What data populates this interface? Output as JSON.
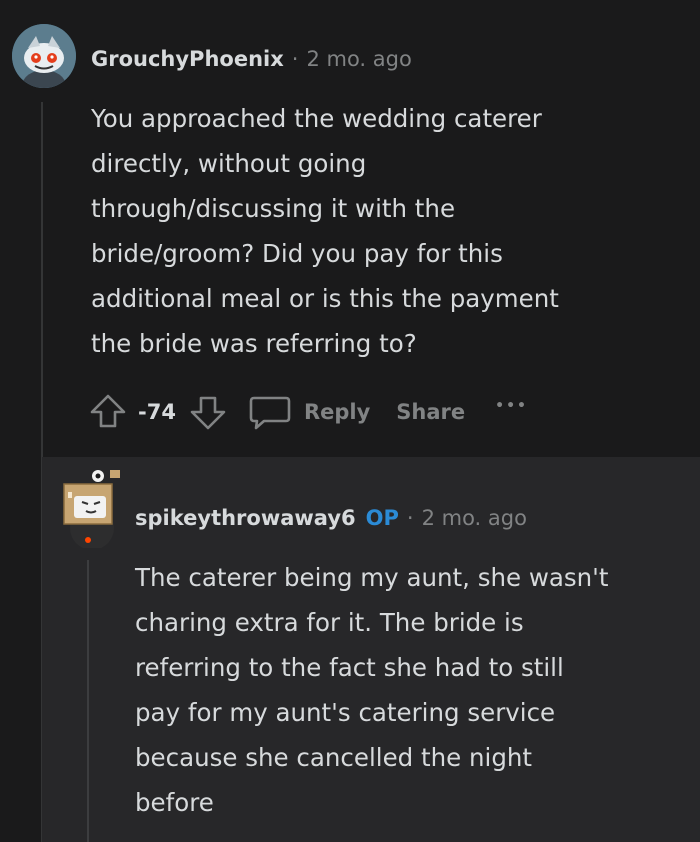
{
  "comment": {
    "author": "GrouchyPhoenix",
    "time": "2 mo. ago",
    "separator": "·",
    "body_lines": [
      "You approached the wedding caterer",
      "directly, without going",
      "through/discussing it with the",
      "bride/groom? Did you pay for this",
      "additional meal or is this the payment",
      "the bride was referring to?"
    ],
    "score": "-74",
    "reply_label": "Reply",
    "share_label": "Share",
    "more_label": "•••"
  },
  "reply": {
    "author": "spikeythrowaway6",
    "op_tag": "OP",
    "time": "2 mo. ago",
    "separator": "·",
    "body_lines": [
      "The caterer being my aunt, she wasn't",
      "charing extra for it. The bride is",
      "referring to the fact she had to still",
      "pay for my aunt's catering service",
      "because she cancelled the night",
      "before"
    ]
  },
  "colors": {
    "background": "#1a1a1b",
    "reply_background": "#272729",
    "text": "#d7dadc",
    "muted": "#818384",
    "op_blue": "#2b8bd6"
  }
}
